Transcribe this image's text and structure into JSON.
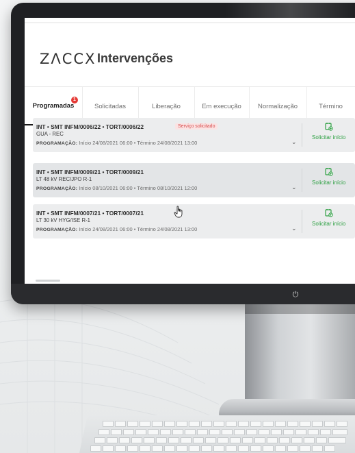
{
  "app": {
    "logo": "ZΛCCX",
    "title": "Intervenções"
  },
  "tabs": [
    {
      "label": "Programadas",
      "badge": "1",
      "active": true
    },
    {
      "label": "Solicitadas"
    },
    {
      "label": "Liberação"
    },
    {
      "label": "Em execução"
    },
    {
      "label": "Normalização"
    },
    {
      "label": "Término"
    }
  ],
  "cards": [
    {
      "code": "INT • SMT INFM/0006/22 • TORT/0006/22",
      "tag": "Serviço solicitado",
      "line": "GUA - REC",
      "prog_label": "PROGRAMAÇÃO:",
      "prog_text": "Início 24/08/2021 06:00 • Término 24/08/2021 13:00",
      "action": "Solicitar início"
    },
    {
      "code": "INT • SMT INFM/0009/21 • TORT/0009/21",
      "line": "LT 48 kV REC/JPO R-1",
      "prog_label": "PROGRAMAÇÃO:",
      "prog_text": "Início 08/10/2021 06:00 • Término 08/10/2021 12:00",
      "action": "Solicitar início"
    },
    {
      "code": "INT • SMT INFM/0007/21 • TORT/0007/21",
      "dot": ":",
      "line": "LT 30 kV HYG/ISE R-1",
      "prog_label": "PROGRAMAÇÃO:",
      "prog_text": "Início 24/08/2021 06:00 • Término 24/08/2021 13:00",
      "action": "Solicitar início"
    }
  ],
  "colors": {
    "accent_green": "#2ea043",
    "badge_red": "#e53935",
    "tag_red": "#d64a4a"
  },
  "icons": {
    "action": "calendar-add-icon",
    "expand": "chevron-down-icon",
    "power": "power-icon"
  }
}
